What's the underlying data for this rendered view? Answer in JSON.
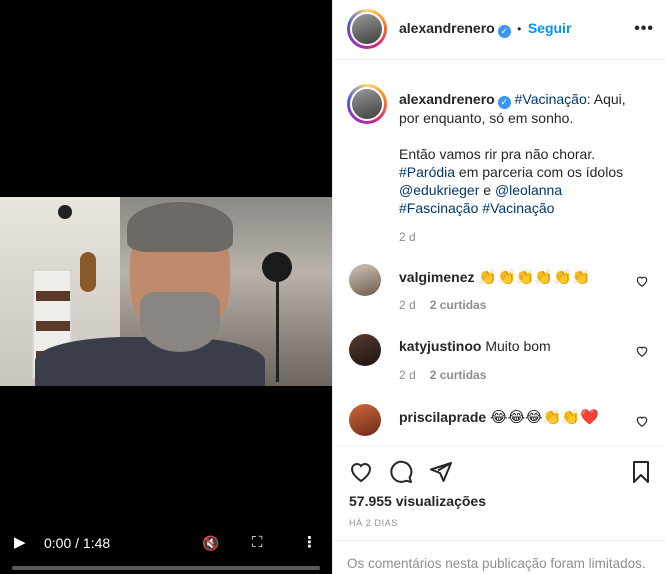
{
  "post": {
    "author": "alexandrenero",
    "follow_label": "Seguir",
    "more_label": "•••",
    "verified_glyph": "✓",
    "separator": "•"
  },
  "caption": {
    "author": "alexandrenero",
    "line1_tag": "#Vacinação",
    "line1_rest": ": Aqui, por enquanto, só em sonho.",
    "line2": "Então vamos rir pra não chorar.",
    "line3_tag": "#Paródia",
    "line3_rest": " em parceria com os ídolos",
    "mention1": "@edukrieger",
    "and_word": " e ",
    "mention2": "@leolanna",
    "tag4": "#Fascinação",
    "tag5": "#Vacinação",
    "time": "2 d"
  },
  "comments": [
    {
      "user": "valgimenez",
      "text": "👏👏👏👏👏👏",
      "time": "2 d",
      "likes": "2 curtidas"
    },
    {
      "user": "katyjustinoo",
      "text": "Muito bom",
      "time": "2 d",
      "likes": "2 curtidas"
    },
    {
      "user": "priscilaprade",
      "text": "😂😂😂👏👏❤️",
      "time": "",
      "likes": ""
    }
  ],
  "stats": {
    "views": "57.955 visualizações",
    "ago": "HÁ 2 DIAS"
  },
  "limited_notice": "Os comentários nesta publicação foram limitados.",
  "video": {
    "time": "0:00 / 1:48",
    "play_glyph": "▶",
    "mute_glyph": "🔇",
    "fullscreen_glyph": "⛶",
    "menu_glyph": "⋮",
    "progress": 0.0
  },
  "icons": {
    "heart": "heart-icon",
    "comment": "comment-icon",
    "share": "share-icon",
    "bookmark": "bookmark-icon"
  },
  "colors": {
    "link": "#00376b",
    "follow": "#0095f6",
    "verified": "#3897f0",
    "secondary": "#8e8e8e"
  }
}
